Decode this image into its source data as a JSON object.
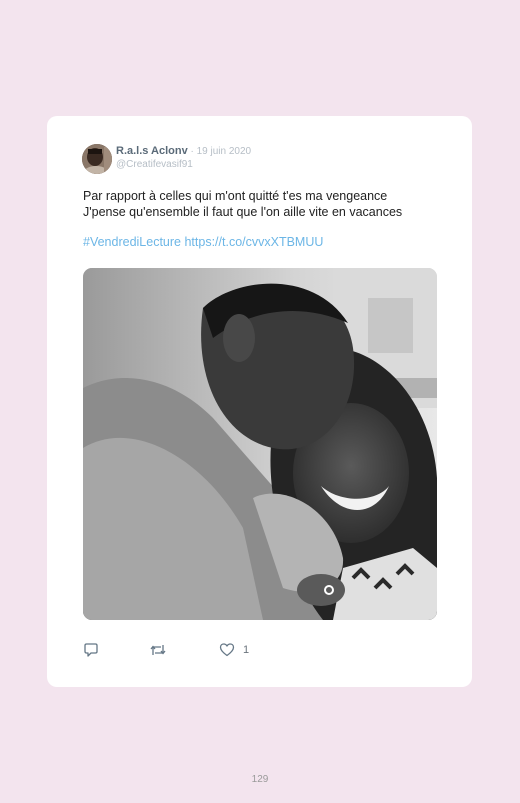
{
  "tweet": {
    "author_name": "R.a.l.s Aclonv",
    "separator": " · ",
    "date": "19 juin 2020",
    "handle": "@Creatifevasif91",
    "text_lines": [
      "Par rapport à celles qui m'ont quitté t'es ma vengeance",
      "J'pense qu'ensemble il faut que l'on aille vite en vacances"
    ],
    "hashtag": "#VendrediLecture",
    "link": "https://t.co/cvvxXTBMUU",
    "like_count": "1"
  },
  "icons": {
    "reply": "reply-icon",
    "retweet": "retweet-icon",
    "like": "heart-icon"
  },
  "colors": {
    "page_background": "#f3e4ee",
    "card_background": "#ffffff",
    "link": "#6cb6e6",
    "author_name": "#5a6a78",
    "muted": "#b6bec6"
  },
  "page": {
    "number": "129"
  }
}
